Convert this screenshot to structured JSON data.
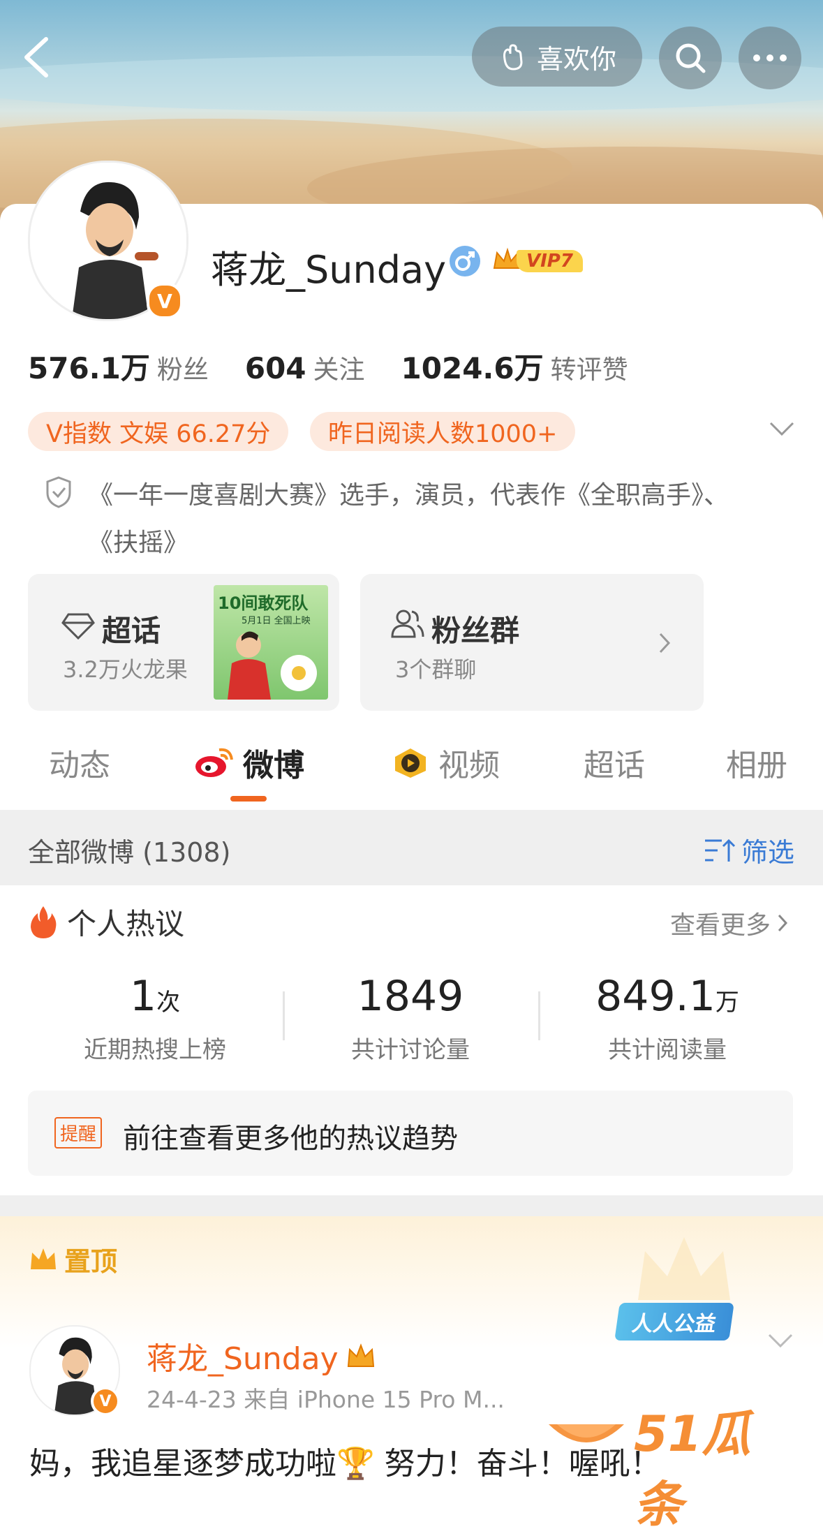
{
  "header": {
    "like_label": "喜欢你"
  },
  "profile": {
    "name": "蒋龙_Sunday",
    "vip": "VIP7",
    "verified_badge": "V",
    "stats": [
      {
        "value": "576.1万",
        "label": "粉丝"
      },
      {
        "value": "604",
        "label": "关注"
      },
      {
        "value": "1024.6万",
        "label": "转评赞"
      }
    ],
    "tags": [
      "V指数 文娱 66.27分",
      "昨日阅读人数1000+"
    ],
    "bio": "《一年一度喜剧大赛》选手，演员，代表作《全职高手》、《扶摇》"
  },
  "cards": {
    "super_topic": {
      "title": "超话",
      "sub": "3.2万火龙果"
    },
    "poster": {
      "line1": "10间敢死队",
      "line2": "5月1日 全国上映"
    },
    "fan_group": {
      "title": "粉丝群",
      "sub": "3个群聊"
    }
  },
  "tabs": [
    {
      "label": "动态",
      "active": false
    },
    {
      "label": "微博",
      "active": true
    },
    {
      "label": "视频",
      "active": false
    },
    {
      "label": "超话",
      "active": false
    },
    {
      "label": "相册",
      "active": false
    }
  ],
  "filter_bar": {
    "all_label": "全部微博 (1308)",
    "filter_label": "筛选"
  },
  "hot": {
    "title": "个人热议",
    "more": "查看更多",
    "stats": [
      {
        "num": "1",
        "unit": "次",
        "label": "近期热搜上榜"
      },
      {
        "num": "1849",
        "unit": "",
        "label": "共计讨论量"
      },
      {
        "num": "849.1",
        "unit": "万",
        "label": "共计阅读量"
      }
    ],
    "reminder_tag": "提醒",
    "reminder_text": "前往查看更多他的热议趋势"
  },
  "pinned": {
    "label": "置顶",
    "badge": "人人公益",
    "author": "蒋龙_Sunday",
    "meta": "24-4-23  来自 iPhone 15 Pro M...",
    "text": "妈，我追星逐梦成功啦🏆 努力！奋斗！喔吼！"
  },
  "watermark": {
    "text": "51瓜条"
  },
  "colors": {
    "accent": "#f0651f",
    "orange": "#f68b1f",
    "link_blue": "#3a7bd5",
    "gold": "#e8a21c"
  }
}
